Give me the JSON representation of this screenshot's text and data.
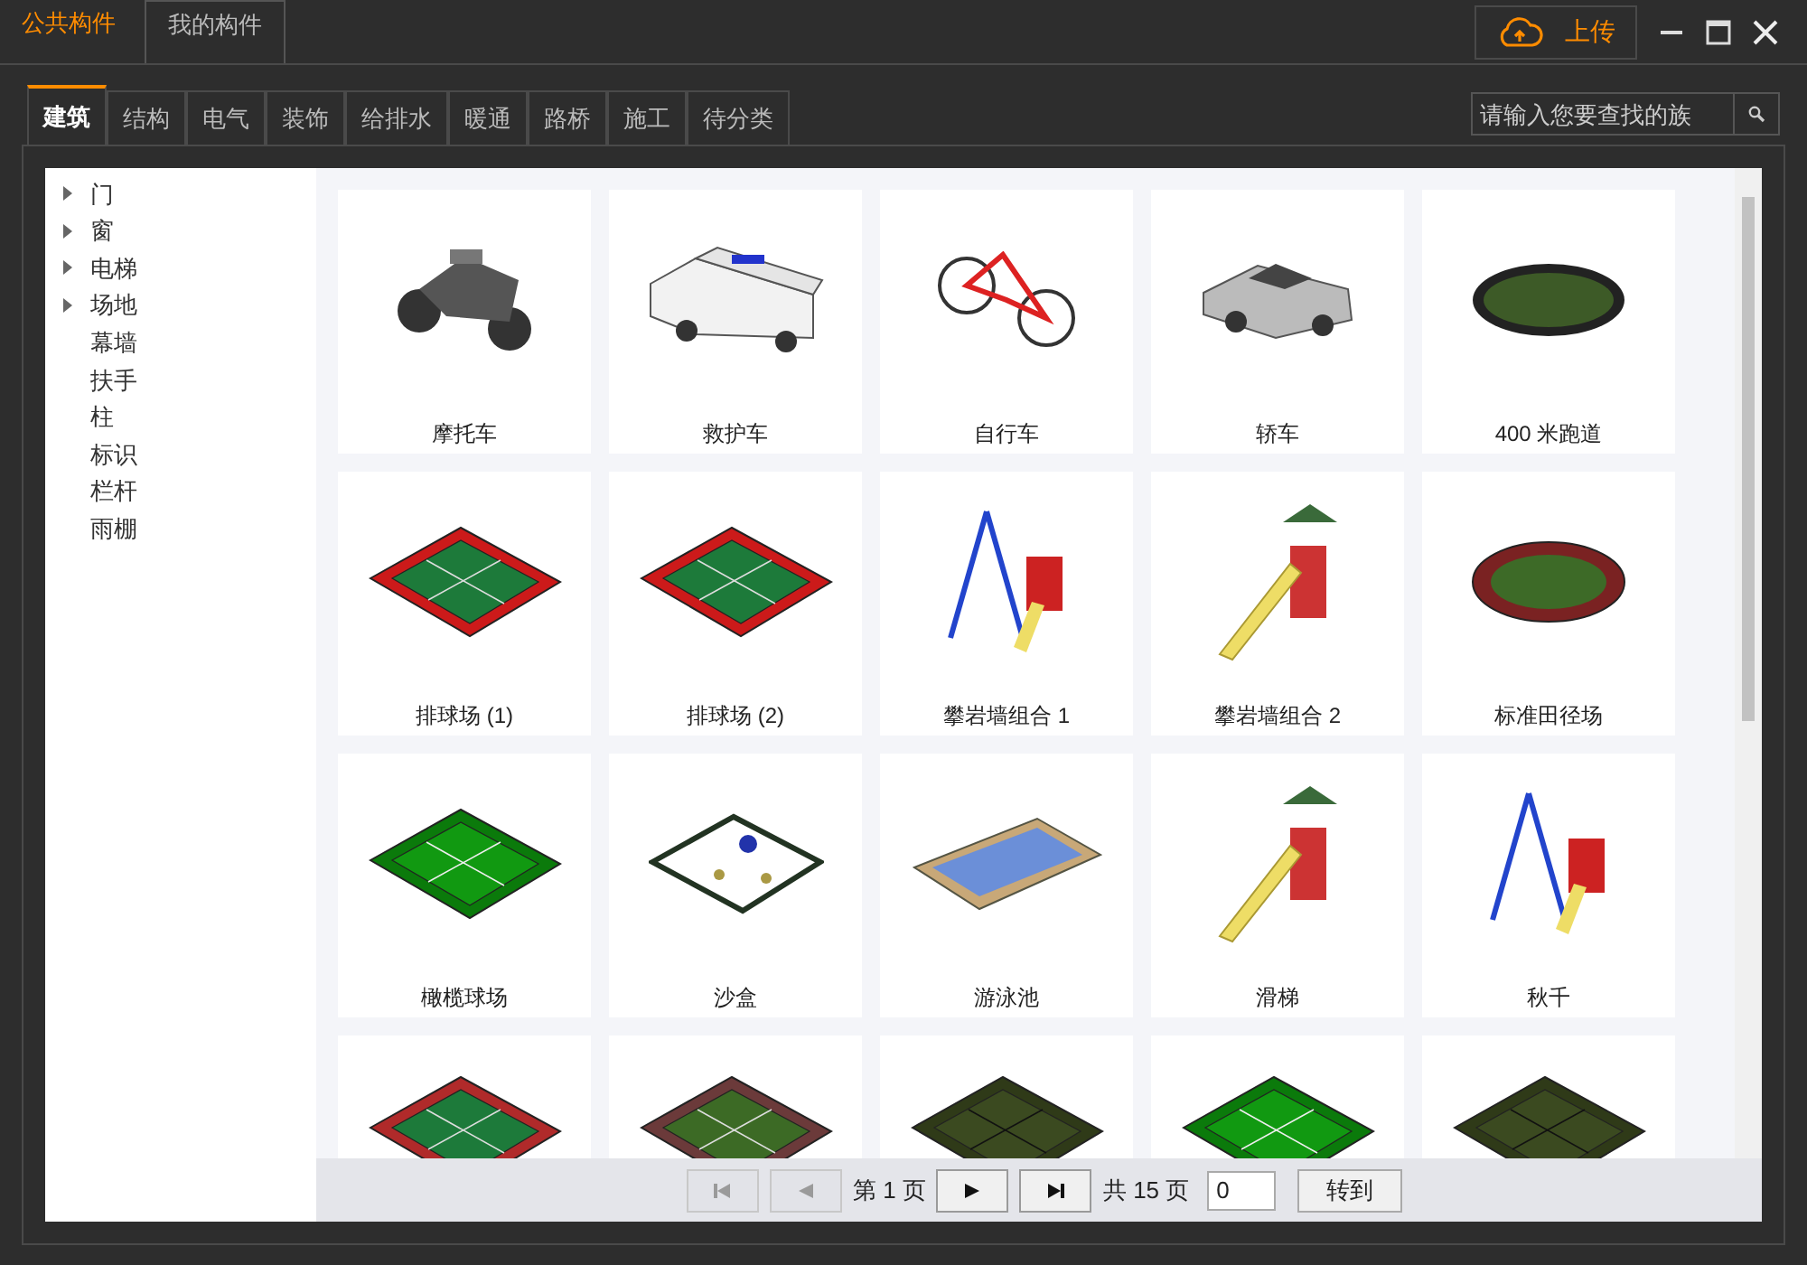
{
  "top_tabs": [
    {
      "label": "公共构件",
      "selected": true
    },
    {
      "label": "我的构件",
      "selected": false
    }
  ],
  "upload_button": {
    "label": "上传"
  },
  "category_tabs": [
    {
      "label": "建筑",
      "selected": true
    },
    {
      "label": "结构",
      "selected": false
    },
    {
      "label": "电气",
      "selected": false
    },
    {
      "label": "装饰",
      "selected": false
    },
    {
      "label": "给排水",
      "selected": false
    },
    {
      "label": "暖通",
      "selected": false
    },
    {
      "label": "路桥",
      "selected": false
    },
    {
      "label": "施工",
      "selected": false
    },
    {
      "label": "待分类",
      "selected": false
    }
  ],
  "search": {
    "placeholder": "请输入您要查找的族"
  },
  "tree": [
    {
      "label": "门",
      "expandable": true
    },
    {
      "label": "窗",
      "expandable": true
    },
    {
      "label": "电梯",
      "expandable": true
    },
    {
      "label": "场地",
      "expandable": true
    },
    {
      "label": "幕墙",
      "expandable": false
    },
    {
      "label": "扶手",
      "expandable": false
    },
    {
      "label": "柱",
      "expandable": false
    },
    {
      "label": "标识",
      "expandable": false
    },
    {
      "label": "栏杆",
      "expandable": false
    },
    {
      "label": "雨棚",
      "expandable": false
    }
  ],
  "items": [
    {
      "label": "摩托车"
    },
    {
      "label": "救护车"
    },
    {
      "label": "自行车"
    },
    {
      "label": "轿车"
    },
    {
      "label": "400 米跑道"
    },
    {
      "label": "排球场 (1)"
    },
    {
      "label": "排球场 (2)"
    },
    {
      "label": "攀岩墙组合 1"
    },
    {
      "label": "攀岩墙组合 2"
    },
    {
      "label": "标准田径场"
    },
    {
      "label": "橄榄球场"
    },
    {
      "label": "沙盒"
    },
    {
      "label": "游泳池"
    },
    {
      "label": "滑梯"
    },
    {
      "label": "秋千"
    },
    {
      "kind": "picture"
    },
    {
      "kind": "picture"
    },
    {
      "kind": "picture"
    },
    {
      "kind": "picture"
    },
    {
      "kind": "picture"
    }
  ],
  "pager": {
    "first_disabled": true,
    "prev_disabled": true,
    "next_disabled": false,
    "last_disabled": false,
    "page_text": "第 1 页",
    "total_text": "共 15 页",
    "page_input": "0",
    "go_label": "转到"
  }
}
